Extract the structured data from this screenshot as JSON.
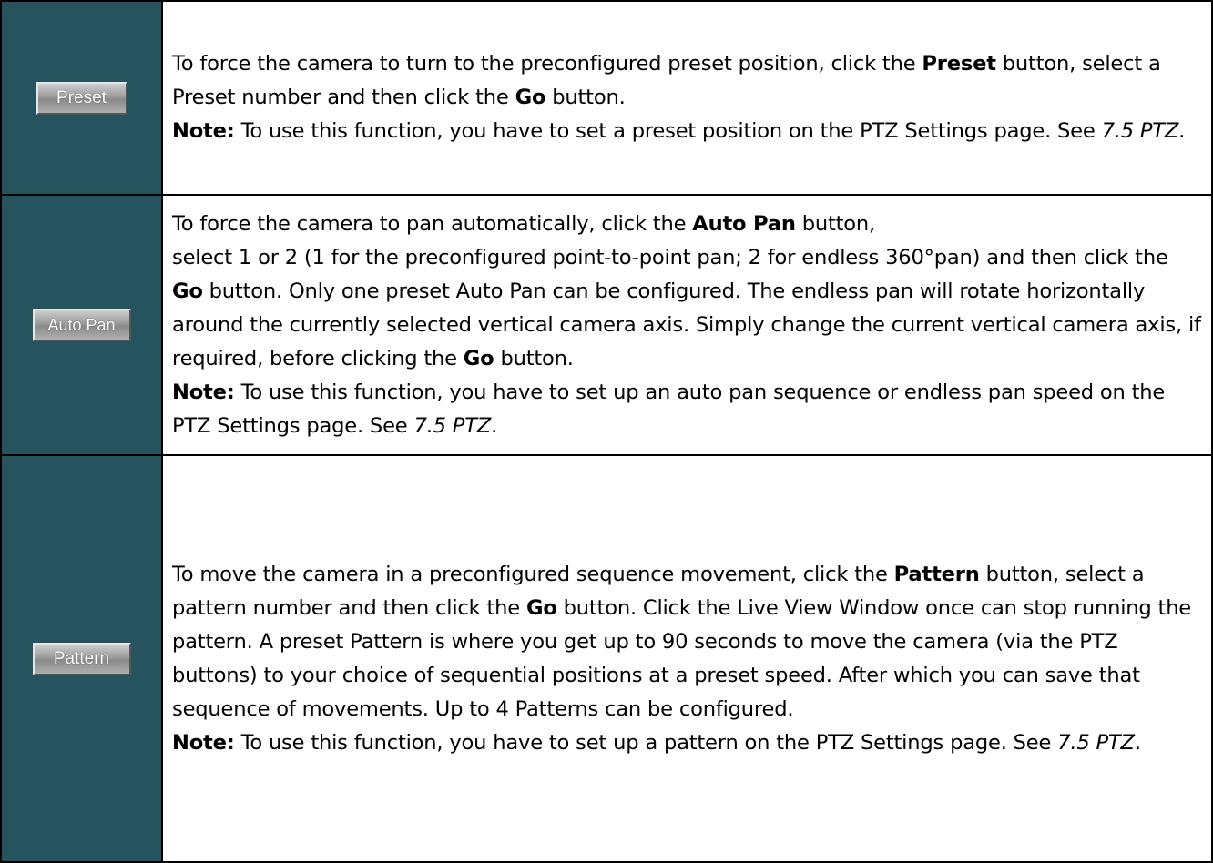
{
  "rows": [
    {
      "button_label": "Preset",
      "t1": "To force the camera to turn to the preconfigured preset position, click the ",
      "b1": "Preset",
      "t2": " button, select a Preset number and then click the ",
      "b2": "Go",
      "t3": " button.",
      "note_label": "Note:",
      "note_text": " To use this function, you have to set a preset position on the PTZ Settings page. See ",
      "note_ref": "7.5 PTZ",
      "note_end": "."
    },
    {
      "button_label": "Auto Pan",
      "t1": "To force the camera to pan automatically, click the ",
      "b1": "Auto Pan",
      "t2": " button,",
      "t3": "select 1 or 2 (1 for the preconfigured point-to-point pan; 2 for endless 360°pan) and then click the ",
      "b2": "Go",
      "t4": " button. Only one preset Auto Pan can be configured. The endless pan will rotate horizontally around the currently selected vertical camera axis. Simply change the current vertical camera axis, if required, before clicking the ",
      "b3": "Go",
      "t5": " button.",
      "note_label": "Note:",
      "note_text": " To use this function, you have to set up an auto pan sequence or endless pan speed on the PTZ Settings page. See ",
      "note_ref": "7.5 PTZ",
      "note_end": "."
    },
    {
      "button_label": "Pattern",
      "t1": "To move the camera in a preconfigured sequence movement, click the ",
      "b1": "Pattern",
      "t2": " button, select a pattern number and then click the ",
      "b2": "Go",
      "t3": " button. Click the Live View Window once can stop running the pattern. A preset Pattern is where you get up to 90 seconds to move the camera (via the PTZ buttons) to your choice of sequential positions at a preset speed. After which you can save that sequence of movements. Up to 4 Patterns can be configured.",
      "note_label": "Note:",
      "note_text": " To use this function, you have to set up a pattern on the PTZ Settings page. See ",
      "note_ref": "7.5 PTZ",
      "note_end": "."
    }
  ]
}
